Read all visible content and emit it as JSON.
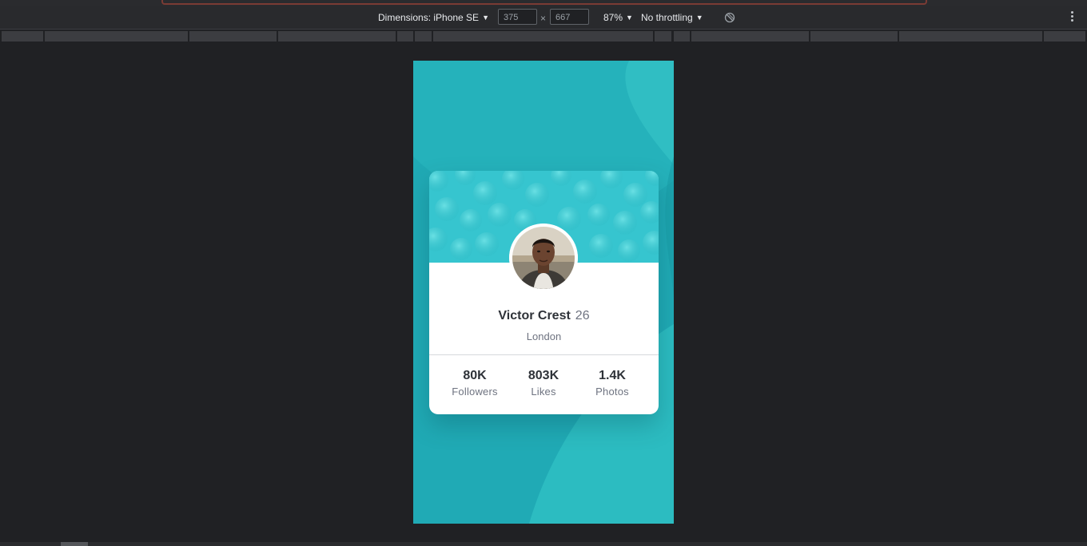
{
  "devtools": {
    "device_label": "Dimensions: iPhone SE",
    "width_value": "375",
    "times_sign": "×",
    "height_value": "667",
    "zoom": "87%",
    "throttling": "No throttling",
    "rotate_icon": "rotate-icon",
    "more_icon": "more-vertical-icon"
  },
  "profile": {
    "name": "Victor Crest",
    "age": "26",
    "city": "London",
    "stats": [
      {
        "value": "80K",
        "label": "Followers"
      },
      {
        "value": "803K",
        "label": "Likes"
      },
      {
        "value": "1.4K",
        "label": "Photos"
      }
    ]
  },
  "colors": {
    "background_cyan": "#20aab5",
    "card_header": "#36c5cf",
    "devtools_bg": "#202124"
  }
}
